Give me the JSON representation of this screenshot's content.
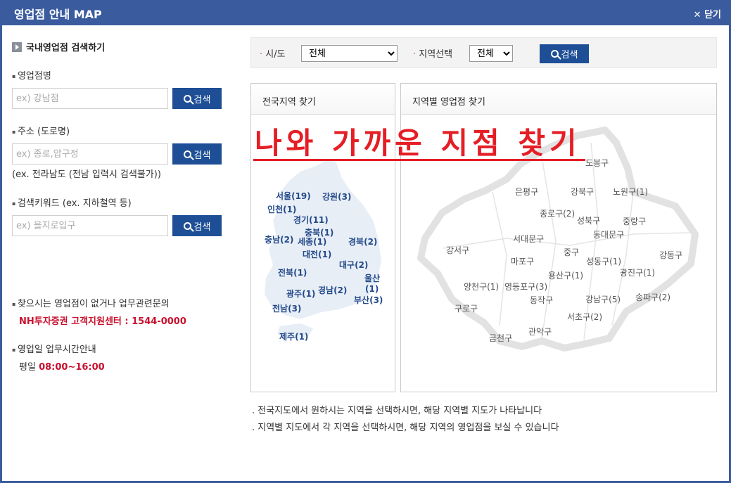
{
  "window": {
    "title": "영업점 안내 MAP",
    "close_label": "✕ 닫기"
  },
  "left": {
    "section_title": "국내영업점 검색하기",
    "fields": [
      {
        "label": "영업점명",
        "placeholder": "ex) 강남점",
        "button": "검색"
      },
      {
        "label": "주소 (도로명)",
        "placeholder": "ex) 종로,압구정",
        "button": "검색",
        "hint": "(ex. 전라남도 (전남 입력시 검색불가))"
      },
      {
        "label": "검색키워드 (ex. 지하철역 등)",
        "placeholder": "ex) 을지로입구",
        "button": "검색"
      }
    ],
    "contact_note": "찾으시는 영업점이 없거나 업무관련문의",
    "contact_line": "NH투자증권 고객지원센터 : 1544-0000",
    "hours_title": "영업일 업무시간안내",
    "hours_prefix": "평일",
    "hours_value": "08:00~16:00"
  },
  "filter": {
    "sido_label": "시/도",
    "sido_value": "전체",
    "region_label": "지역선택",
    "region_value": "전체",
    "search_button": "검색"
  },
  "panels": {
    "national_title": "전국지역 찾기",
    "regional_title": "지역별 영업점 찾기"
  },
  "overlay_text": "나와 가까운 지점 찾기",
  "korea_regions": [
    "서울(19)",
    "강원(3)",
    "인천(1)",
    "경기(11)",
    "충북(1)",
    "충남(2)",
    "세종(1)",
    "경북(2)",
    "대전(1)",
    "대구(2)",
    "전북(1)",
    "울산",
    "(1)",
    "광주(1)",
    "경남(2)",
    "부산(3)",
    "전남(3)",
    "제주(1)"
  ],
  "seoul_districts": [
    "도봉구",
    "은평구",
    "강북구",
    "노원구(1)",
    "종로구(2)",
    "성북구",
    "중랑구",
    "서대문구",
    "동대문구",
    "강서구",
    "중구",
    "강동구",
    "마포구",
    "성동구(1)",
    "광진구(1)",
    "용산구(1)",
    "양천구(1)",
    "영등포구(3)",
    "구로구",
    "동작구",
    "강남구(5)",
    "송파구(2)",
    "서초구(2)",
    "금천구",
    "관악구"
  ],
  "footnotes": [
    "전국지도에서 원하시는 지역을 선택하시면, 해당 지역별 지도가 나타납니다",
    "지역별 지도에서 각 지역을 선택하시면, 해당 지역의 영업점을 보실 수 있습니다"
  ]
}
